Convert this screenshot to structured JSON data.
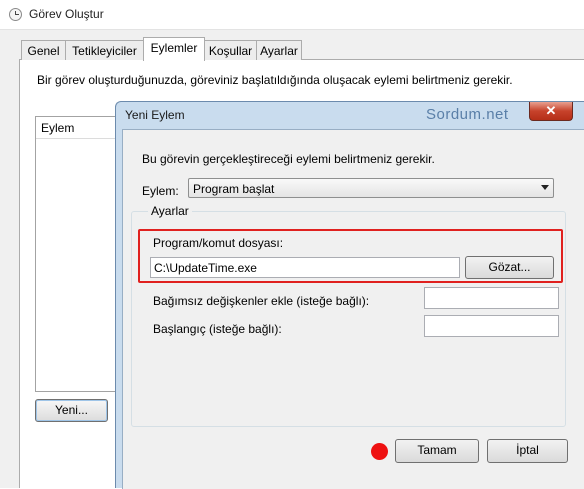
{
  "window": {
    "title": "Görev Oluştur",
    "icon": "clock-icon"
  },
  "tabs": [
    {
      "label": "Genel"
    },
    {
      "label": "Tetikleyiciler"
    },
    {
      "label": "Eylemler",
      "active": true
    },
    {
      "label": "Koşullar"
    },
    {
      "label": "Ayarlar"
    }
  ],
  "actions_panel": {
    "description": "Bir görev oluşturduğunuzda, göreviniz başlatıldığında oluşacak eylemi belirtmeniz gerekir.",
    "list_header": "Eylem",
    "new_button": "Yeni..."
  },
  "dialog": {
    "title": "Yeni Eylem",
    "watermark": "Sordum.net",
    "close_label": "✕",
    "description": "Bu görevin gerçekleştireceği eylemi belirtmeniz gerekir.",
    "action_label": "Eylem:",
    "action_value": "Program başlat",
    "settings_legend": "Ayarlar",
    "program_label": "Program/komut dosyası:",
    "program_value": "C:\\UpdateTime.exe",
    "browse_button": "Gözat...",
    "args_label": "Bağımsız değişkenler ekle (isteğe bağlı):",
    "args_value": "",
    "start_label": "Başlangıç (isteğe bağlı):",
    "start_value": "",
    "ok_button": "Tamam",
    "cancel_button": "İptal",
    "highlight_color": "#e0211f",
    "marker_color": "#ee1111"
  }
}
